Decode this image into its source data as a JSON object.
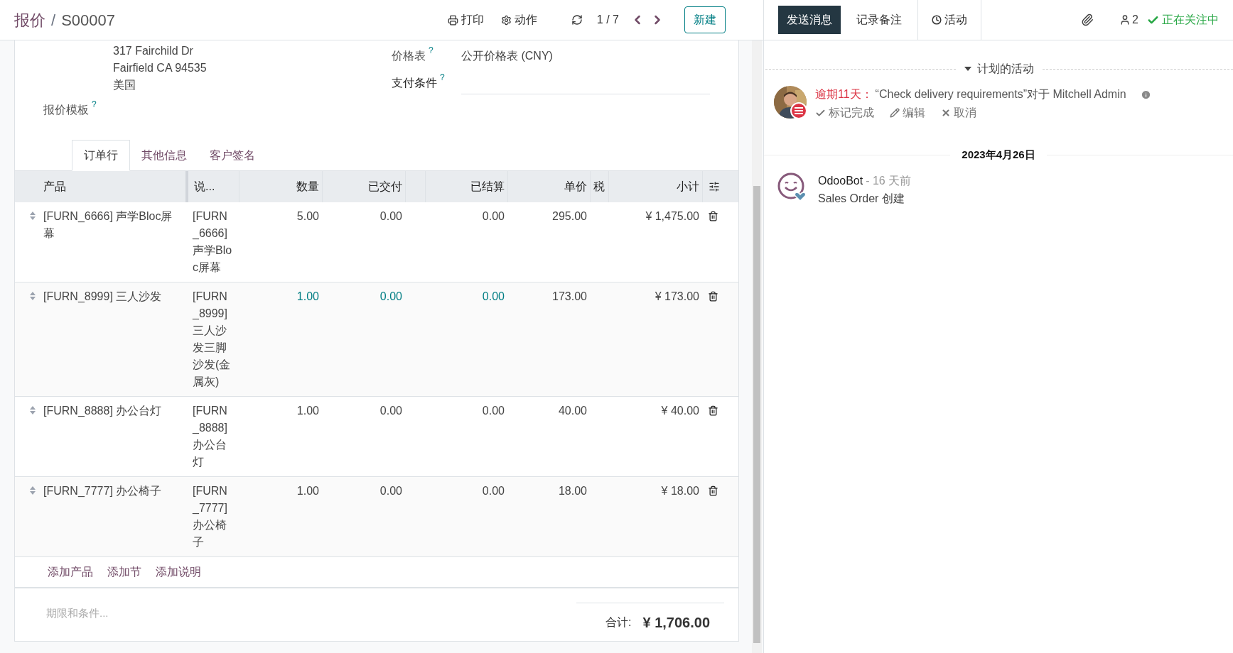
{
  "breadcrumb": {
    "parent": "报价",
    "separator": "/",
    "current": "S00007"
  },
  "toolbar": {
    "print": "打印",
    "action": "动作",
    "pager": "1 / 7",
    "new": "新建"
  },
  "address": [
    "317 Fairchild Dr",
    "Fairfield CA 94535",
    "美国"
  ],
  "fields": [
    {
      "label": "价格表",
      "help": "?",
      "value": "公开价格表 (CNY)"
    },
    {
      "label": "支付条件",
      "help": "?"
    }
  ],
  "quote_template": {
    "label": "报价模板",
    "help": "?"
  },
  "tabs": [
    {
      "label": "订单行",
      "selected": true
    },
    {
      "label": "其他信息",
      "selected": false
    },
    {
      "label": "客户签名",
      "selected": false
    }
  ],
  "table": {
    "columns": [
      "产品",
      "说...",
      "数量",
      "已交付",
      "已结算",
      "单价",
      "税",
      "小计"
    ],
    "rows": [
      {
        "product": "[FURN_6666] 声学Bloc屏幕",
        "description": "[FURN_6666] 声学Bloc屏幕",
        "quantity": "5.00",
        "delivered": "0.00",
        "invoiced": "0.00",
        "unit_price": "295.00",
        "subtotal": "¥ 1,475.00",
        "highlighted": false
      },
      {
        "product": "[FURN_8999] 三人沙发",
        "description": "[FURN_8999] 三人沙发三脚沙发(金属灰)",
        "quantity": "1.00",
        "delivered": "0.00",
        "invoiced": "0.00",
        "unit_price": "173.00",
        "subtotal": "¥ 173.00",
        "highlighted": true
      },
      {
        "product": "[FURN_8888] 办公台灯",
        "description": "[FURN_8888] 办公台灯",
        "quantity": "1.00",
        "delivered": "0.00",
        "invoiced": "0.00",
        "unit_price": "40.00",
        "subtotal": "¥ 40.00",
        "highlighted": false
      },
      {
        "product": "[FURN_7777] 办公椅子",
        "description": "[FURN_7777] 办公椅子",
        "quantity": "1.00",
        "delivered": "0.00",
        "invoiced": "0.00",
        "unit_price": "18.00",
        "subtotal": "¥ 18.00",
        "highlighted": false
      }
    ],
    "add_links": [
      "添加产品",
      "添加节",
      "添加说明"
    ]
  },
  "terms": {
    "placeholder": "期限和条件..."
  },
  "total": {
    "label": "合计:",
    "value": "¥ 1,706.00"
  },
  "chatter": {
    "buttons": [
      {
        "label": "发送消息",
        "selected": true,
        "kind": "message"
      },
      {
        "label": "记录备注",
        "selected": false,
        "kind": "note"
      },
      {
        "label": "活动",
        "selected": false,
        "kind": "activity"
      }
    ],
    "followers_count": "2",
    "following": "正在关注中",
    "planned_title": "计划的活动",
    "activity": {
      "overdue": "逾期11天：",
      "summary": "“Check delivery requirements”对于 Mitchell Admin",
      "actions": [
        "标记完成",
        "编辑",
        "取消"
      ]
    },
    "date": "2023年4月26日",
    "message": {
      "author": "OdooBot",
      "time": "- 16 天前",
      "body": "Sales Order 创建"
    }
  }
}
